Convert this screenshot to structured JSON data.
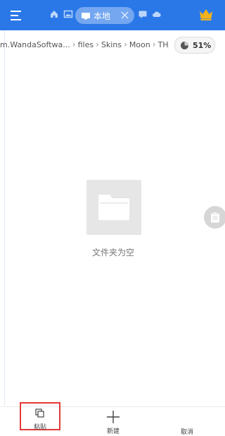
{
  "colors": {
    "topbar": "#2a78e8",
    "highlight_border": "#e23a3a",
    "crown": "#f3b21b"
  },
  "header": {
    "tab_label": "本地",
    "icons": [
      "menu-icon",
      "home-icon",
      "image-icon",
      "phone-icon",
      "close-icon",
      "chat-icon",
      "cloud-icon",
      "crown-icon"
    ]
  },
  "breadcrumb": [
    "m.WandaSoftwa...",
    "files",
    "Skins",
    "Moon",
    "THA"
  ],
  "storage": {
    "percent_label": "51%",
    "percent_value": 51
  },
  "empty_state": {
    "message": "文件夹为空",
    "icon": "folder-icon"
  },
  "bottom_bar": {
    "paste_label": "粘贴",
    "new_label": "新建",
    "cancel_label": "取消"
  }
}
